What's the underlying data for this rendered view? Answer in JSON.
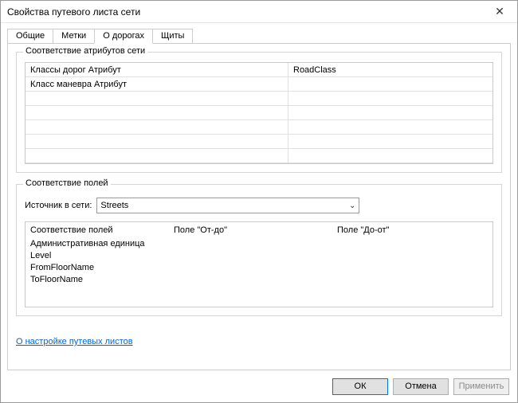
{
  "window": {
    "title": "Свойства путевого листа сети"
  },
  "tabs": {
    "t0": "Общие",
    "t1": "Метки",
    "t2": "О дорогах",
    "t3": "Щиты"
  },
  "group1": {
    "title": "Соответствие атрибутов сети",
    "rows": {
      "r0": {
        "label": "Классы дорог Атрибут",
        "value": "RoadClass"
      },
      "r1": {
        "label": "Класс маневра Атрибут",
        "value": ""
      }
    }
  },
  "group2": {
    "title": "Соответствие полей",
    "source_label": "Источник в сети:",
    "source_value": "Streets",
    "headers": {
      "h0": "Соответствие полей",
      "h1": "Поле \"От-до\"",
      "h2": "Поле \"До-от\""
    },
    "rows": {
      "r0": "Административная единица",
      "r1": "Level",
      "r2": "FromFloorName",
      "r3": "ToFloorName"
    }
  },
  "help_link": "О настройке путевых листов",
  "buttons": {
    "ok": "ОК",
    "cancel": "Отмена",
    "apply": "Применить"
  }
}
